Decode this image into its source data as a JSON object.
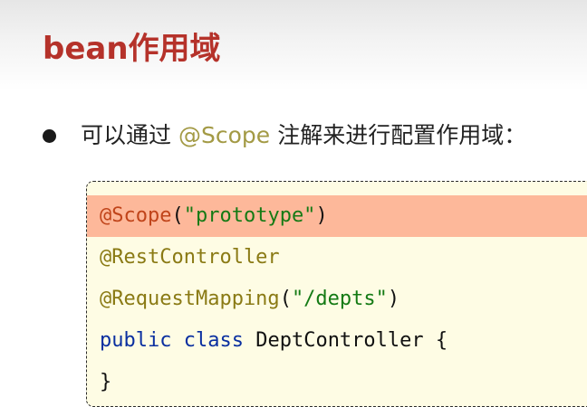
{
  "title": "bean作用域",
  "bullet": {
    "before": "可以通过",
    "annotation": "@Scope",
    "after": "注解来进行配置作用域："
  },
  "code": {
    "line1": {
      "annotation": "@Scope",
      "open": "(",
      "string": "\"prototype\"",
      "close": ")"
    },
    "line2": {
      "annotation": "@RestController"
    },
    "line3": {
      "annotation": "@RequestMapping",
      "open": "(",
      "string": "\"/depts\"",
      "close": ")"
    },
    "line4": {
      "kw1": "public",
      "kw2": "class",
      "rest": "DeptController {"
    },
    "line5": {
      "text": "}"
    }
  },
  "colors": {
    "title": "#b5322a",
    "annotation_highlight": "#c0441a",
    "annotation": "#8a7a14",
    "string": "#147a14",
    "keyword": "#0a2fa0",
    "highlight_background": "#fdb89a",
    "code_background": "#fefce4"
  }
}
